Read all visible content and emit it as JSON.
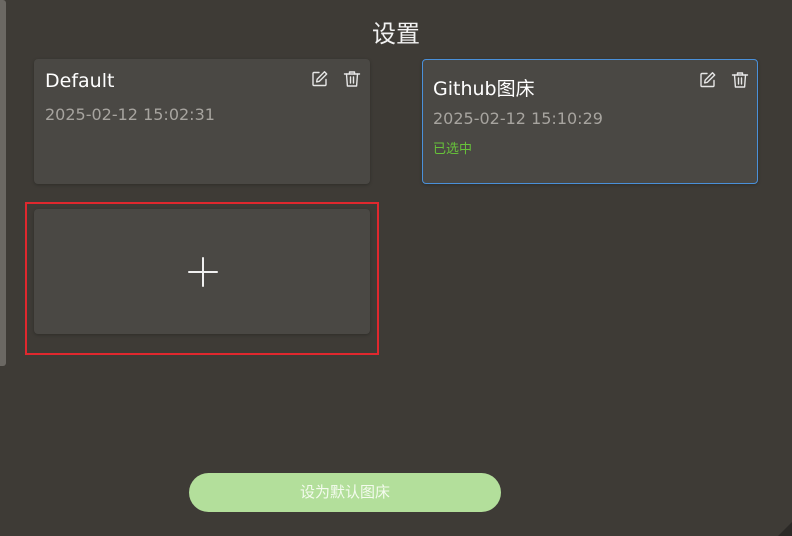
{
  "header": {
    "title": "设置"
  },
  "cards": [
    {
      "name": "Default",
      "date": "2025-02-12 15:02:31",
      "selected_text": ""
    },
    {
      "name": "Github图床",
      "date": "2025-02-12 15:10:29",
      "selected_text": "已选中"
    }
  ],
  "icons": {
    "edit": "edit-icon",
    "delete": "trash-icon",
    "add": "plus-icon"
  },
  "footer": {
    "set_default_label": "设为默认图床"
  },
  "colors": {
    "background": "#3e3b36",
    "card": "#4a4844",
    "selected_border": "#4a90d9",
    "selected_text": "#67c23a",
    "highlight_frame": "#e0282e",
    "primary_button": "#b3df9b"
  }
}
